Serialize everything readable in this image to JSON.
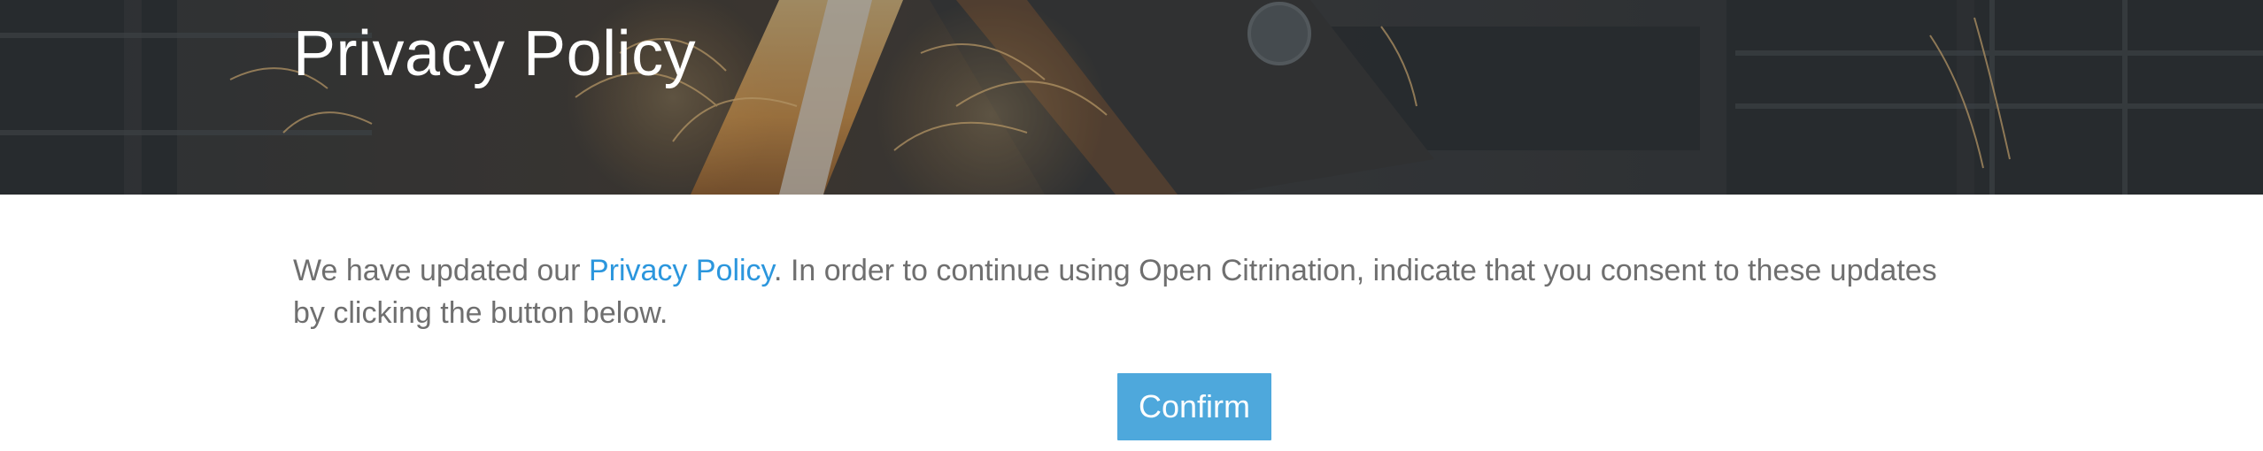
{
  "hero": {
    "title": "Privacy Policy"
  },
  "notice": {
    "before_link": "We have updated our ",
    "link_text": "Privacy Policy",
    "after_link": ". In order to continue using Open Citrination, indicate that you consent to these updates by clicking the button below."
  },
  "actions": {
    "confirm_label": "Confirm"
  },
  "colors": {
    "link": "#2b96dd",
    "button": "#4ea8dc",
    "body_text": "#6f6f6f",
    "hero_overlay": "#3b3f44"
  }
}
